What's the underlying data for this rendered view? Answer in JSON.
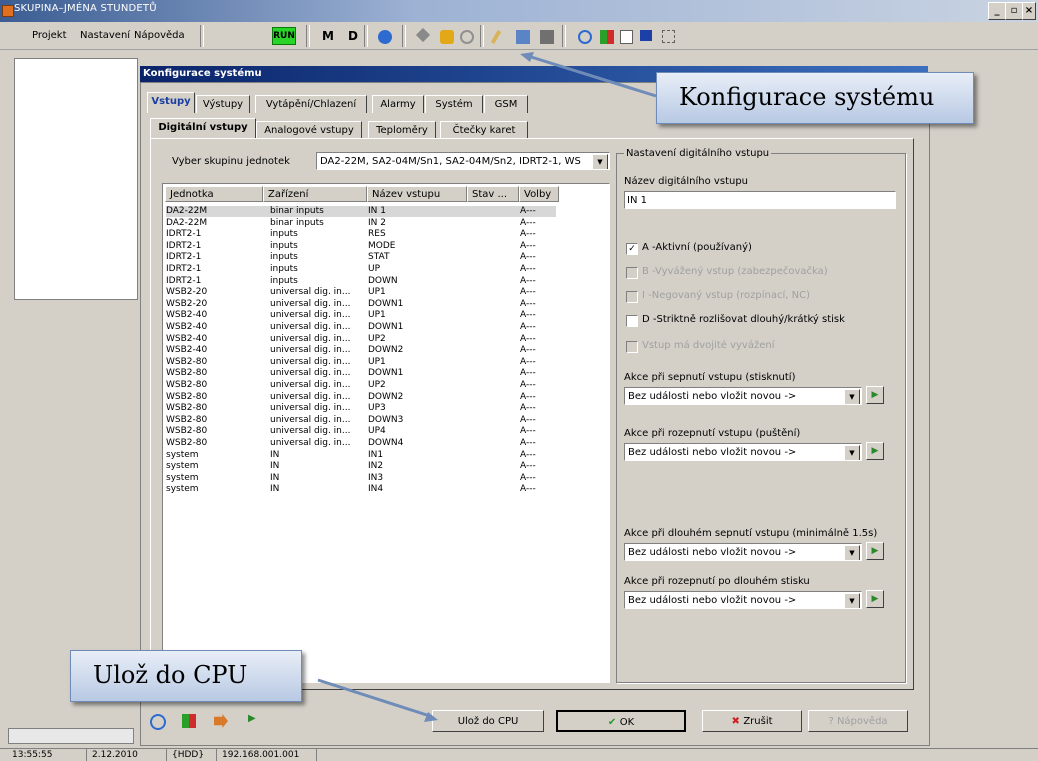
{
  "window": {
    "title": "SKUPINA–JMÉNA STUNDETŮ"
  },
  "menu": {
    "items": [
      "Projekt",
      "Nastavení",
      "Nápověda"
    ],
    "run": "RUN",
    "m": "M",
    "d": "D"
  },
  "dialog": {
    "title": "Konfigurace systému",
    "tabs_top": [
      "Vstupy",
      "Výstupy",
      "Vytápění/Chlazení",
      "Alarmy",
      "Systém",
      "GSM"
    ],
    "tabs_sub": [
      "Digitální vstupy",
      "Analogové vstupy",
      "Teploměry",
      "Čtečky karet"
    ],
    "group_select_label": "Vyber skupinu jednotek",
    "group_select_value": "DA2-22M, SA2-04M/Sn1, SA2-04M/Sn2, IDRT2-1, WS",
    "columns": [
      "Jednotka",
      "Zařízení",
      "Název vstupu",
      "Stav ...",
      "Volby"
    ],
    "rows": [
      [
        "DA2-22M",
        "binar inputs",
        "IN 1",
        "",
        "A---"
      ],
      [
        "DA2-22M",
        "binar inputs",
        "IN 2",
        "",
        "A---"
      ],
      [
        "IDRT2-1",
        "inputs",
        "RES",
        "",
        "A---"
      ],
      [
        "IDRT2-1",
        "inputs",
        "MODE",
        "",
        "A---"
      ],
      [
        "IDRT2-1",
        "inputs",
        "STAT",
        "",
        "A---"
      ],
      [
        "IDRT2-1",
        "inputs",
        "UP",
        "",
        "A---"
      ],
      [
        "IDRT2-1",
        "inputs",
        "DOWN",
        "",
        "A---"
      ],
      [
        "WSB2-20",
        "universal dig. in...",
        "UP1",
        "",
        "A---"
      ],
      [
        "WSB2-20",
        "universal dig. in...",
        "DOWN1",
        "",
        "A---"
      ],
      [
        "WSB2-40",
        "universal dig. in...",
        "UP1",
        "",
        "A---"
      ],
      [
        "WSB2-40",
        "universal dig. in...",
        "DOWN1",
        "",
        "A---"
      ],
      [
        "WSB2-40",
        "universal dig. in...",
        "UP2",
        "",
        "A---"
      ],
      [
        "WSB2-40",
        "universal dig. in...",
        "DOWN2",
        "",
        "A---"
      ],
      [
        "WSB2-80",
        "universal dig. in...",
        "UP1",
        "",
        "A---"
      ],
      [
        "WSB2-80",
        "universal dig. in...",
        "DOWN1",
        "",
        "A---"
      ],
      [
        "WSB2-80",
        "universal dig. in...",
        "UP2",
        "",
        "A---"
      ],
      [
        "WSB2-80",
        "universal dig. in...",
        "DOWN2",
        "",
        "A---"
      ],
      [
        "WSB2-80",
        "universal dig. in...",
        "UP3",
        "",
        "A---"
      ],
      [
        "WSB2-80",
        "universal dig. in...",
        "DOWN3",
        "",
        "A---"
      ],
      [
        "WSB2-80",
        "universal dig. in...",
        "UP4",
        "",
        "A---"
      ],
      [
        "WSB2-80",
        "universal dig. in...",
        "DOWN4",
        "",
        "A---"
      ],
      [
        "system",
        "IN",
        "IN1",
        "",
        "A---"
      ],
      [
        "system",
        "IN",
        "IN2",
        "",
        "A---"
      ],
      [
        "system",
        "IN",
        "IN3",
        "",
        "A---"
      ],
      [
        "system",
        "IN",
        "IN4",
        "",
        "A---"
      ]
    ],
    "settings": {
      "legend": "Nastavení digitálního vstupu",
      "name_label": "Název digitálního vstupu",
      "name_value": "IN 1",
      "checkboxes": [
        {
          "label": "A -Aktivní (používaný)",
          "checked": "✓"
        },
        {
          "label": "B -Vyvážený vstup (zabezpečovačka)",
          "checked": ""
        },
        {
          "label": "I -Negovaný vstup (rozpínací, NC)",
          "checked": ""
        },
        {
          "label": "D -Striktně rozlišovat dlouhý/krátký stisk",
          "checked": ""
        },
        {
          "label": "Vstup má dvojité vyvážení",
          "checked": ""
        }
      ],
      "actions": [
        {
          "label": "Akce při sepnutí vstupu (stisknutí)",
          "value": "Bez události nebo vložit novou ->"
        },
        {
          "label": "Akce při rozepnutí vstupu (puštění)",
          "value": "Bez události nebo vložit novou ->"
        },
        {
          "label": "Akce při dlouhém sepnutí vstupu (minimálně 1.5s)",
          "value": "Bez události nebo vložit novou ->"
        },
        {
          "label": "Akce při rozepnutí po dlouhém stisku",
          "value": "Bez události nebo vložit novou ->"
        }
      ]
    },
    "buttons": {
      "save_cpu": "Ulož do CPU",
      "ok": "OK",
      "cancel": "Zrušit",
      "help": "Nápověda"
    }
  },
  "callouts": {
    "config": "Konfigurace systému",
    "save": "Ulož do CPU"
  },
  "status": {
    "time": "13:55:55",
    "date": "2.12.2010",
    "hdd": "{HDD}",
    "ip": "192.168.001.001"
  },
  "colors": {
    "accent": "#0a246a",
    "run": "#27d427",
    "callout": "#b8c9e3"
  }
}
